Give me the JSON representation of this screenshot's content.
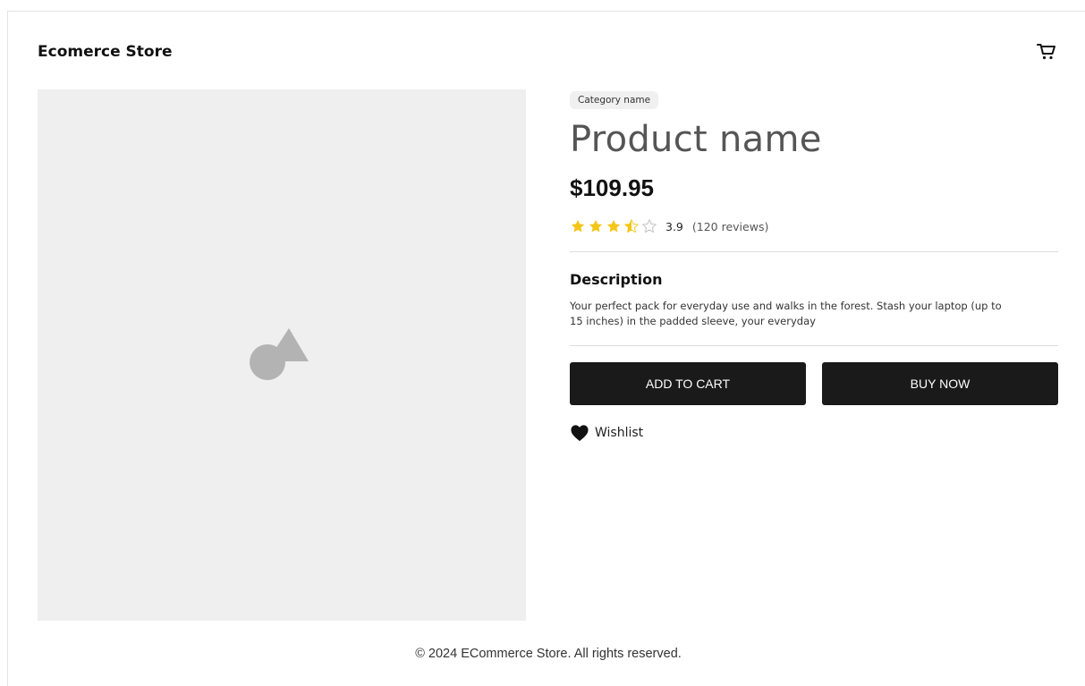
{
  "header": {
    "brand": "Ecomerce Store",
    "cart_icon": "cart-icon"
  },
  "product": {
    "image_placeholder_icon": "image-placeholder-icon",
    "category": "Category name",
    "name": "Product name",
    "price": "$109.95",
    "rating": {
      "value": "3.9",
      "stars_filled": 3.5,
      "stars_total": 5,
      "reviews": "(120 reviews)",
      "star_color": "#f5c518"
    },
    "description_title": "Description",
    "description": "Your perfect pack for everyday use and walks in the forest. Stash your laptop (up to 15 inches) in the padded sleeve, your everyday"
  },
  "actions": {
    "add_to_cart": "ADD TO CART",
    "buy_now": "BUY NOW",
    "wishlist": "Wishlist",
    "wishlist_icon": "heart-icon"
  },
  "footer": {
    "copyright": "© 2024 ECommerce Store. All rights reserved."
  }
}
